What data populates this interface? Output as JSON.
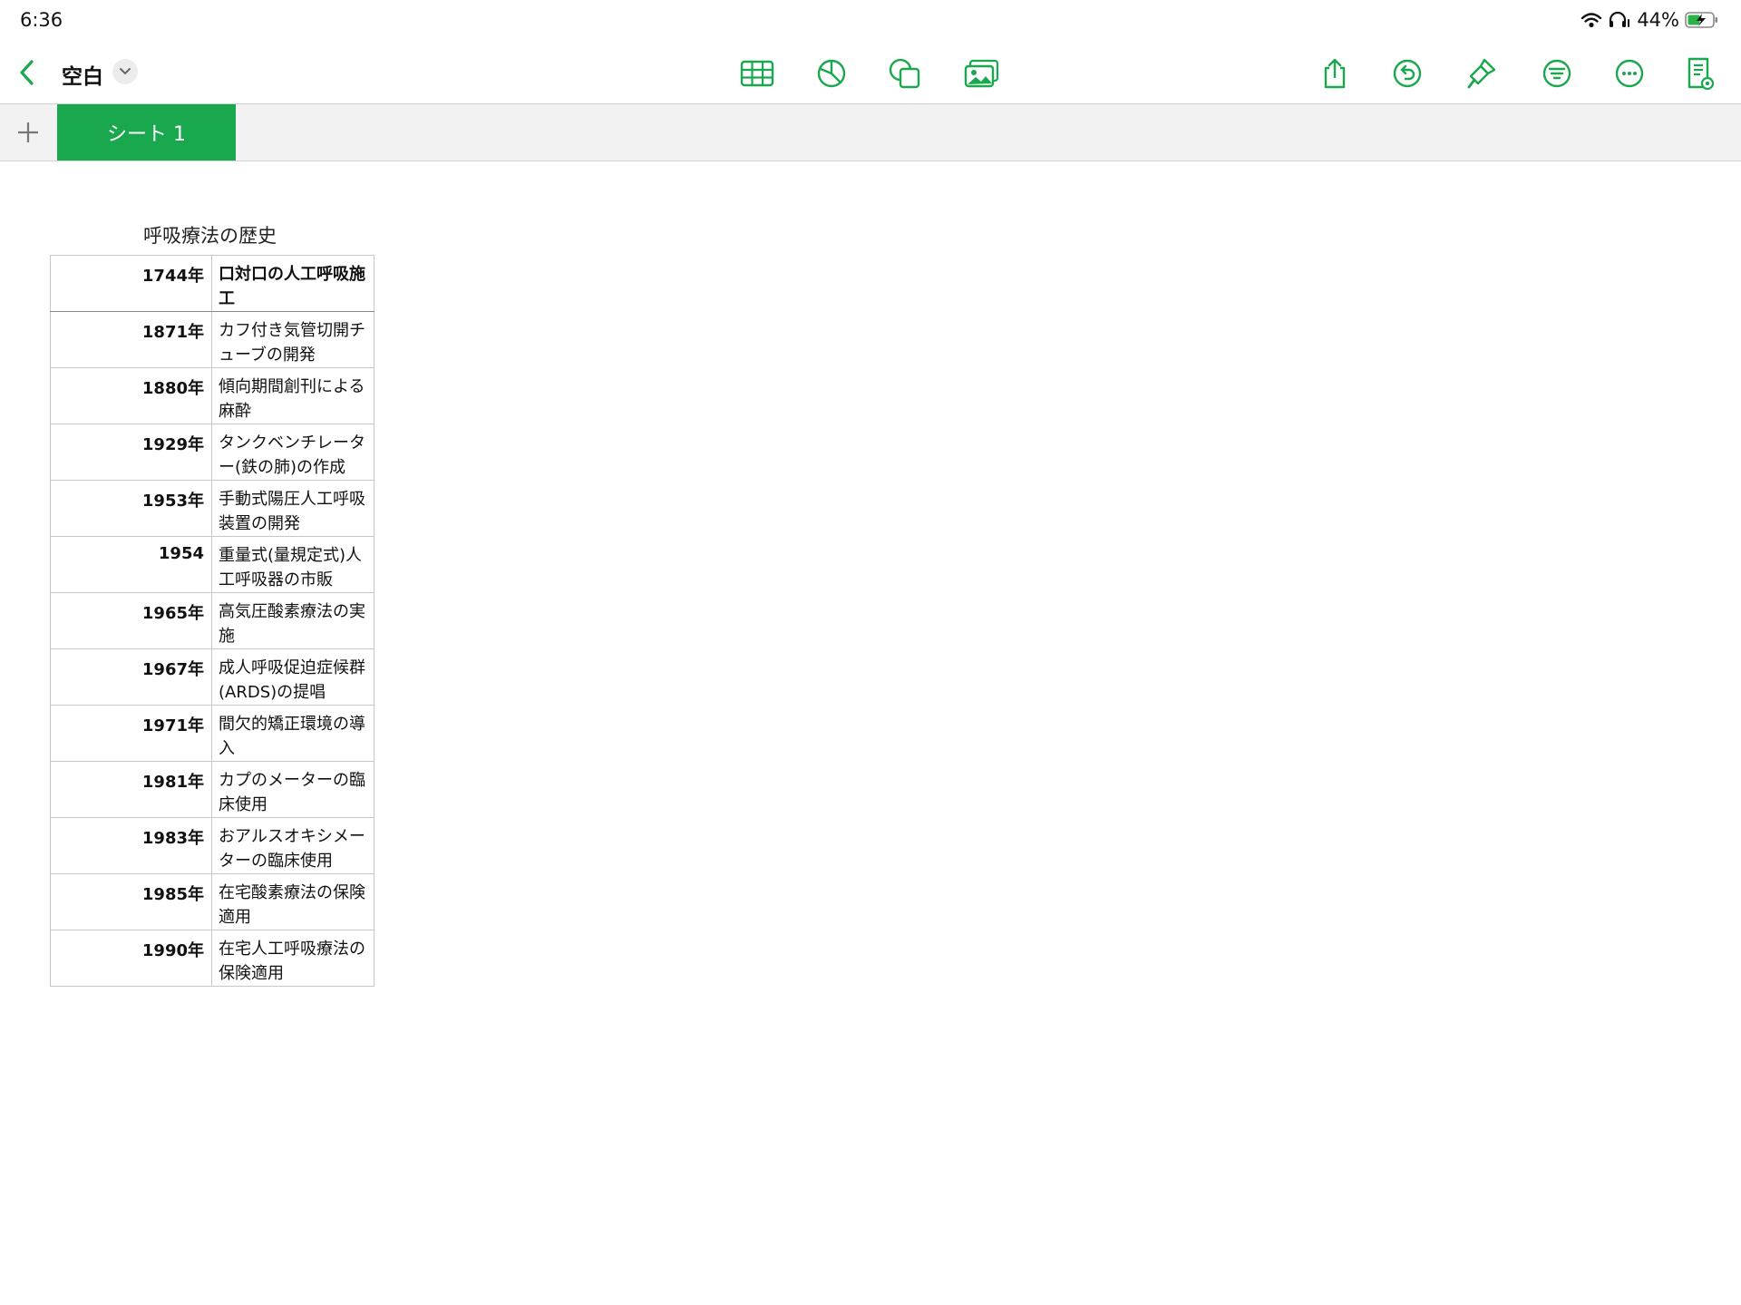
{
  "status_bar": {
    "time": "6:36",
    "battery": "44%"
  },
  "toolbar": {
    "document_title": "空白",
    "icons": [
      "back-chevron-icon",
      "table-icon",
      "chart-icon",
      "shape-icon",
      "media-icon",
      "share-icon",
      "undo-icon",
      "format-brush-icon",
      "organize-icon",
      "more-icon",
      "view-options-icon"
    ]
  },
  "tabs": {
    "add_label": "+",
    "sheets": [
      {
        "label": "シート 1",
        "active": true
      }
    ]
  },
  "table": {
    "title": "呼吸療法の歴史",
    "header": {
      "year": "1744年",
      "event": "口対口の人工呼吸施工"
    },
    "rows": [
      {
        "year": "1871年",
        "event": "カフ付き気管切開チューブの開発"
      },
      {
        "year": "1880年",
        "event": "傾向期間創刊による麻酔"
      },
      {
        "year": "1929年",
        "event": "タンクベンチレーター(鉄の肺)の作成"
      },
      {
        "year": "1953年",
        "event": "手動式陽圧人工呼吸装置の開発"
      },
      {
        "year": "1954",
        "event": "重量式(量規定式)人工呼吸器の市販"
      },
      {
        "year": "1965年",
        "event": "高気圧酸素療法の実施"
      },
      {
        "year": "1967年",
        "event": "成人呼吸促迫症候群(ARDS)の提唱"
      },
      {
        "year": "1971年",
        "event": "間欠的矯正環境の導入"
      },
      {
        "year": "1981年",
        "event": "カプのメーターの臨床使用"
      },
      {
        "year": "1983年",
        "event": "おアルスオキシメーターの臨床使用"
      },
      {
        "year": "1985年",
        "event": "在宅酸素療法の保険適用"
      },
      {
        "year": "1990年",
        "event": "在宅人工呼吸療法の保険適用"
      }
    ]
  },
  "colors": {
    "accent": "#1aa84f",
    "tabbar_bg": "#f2f2f2"
  }
}
